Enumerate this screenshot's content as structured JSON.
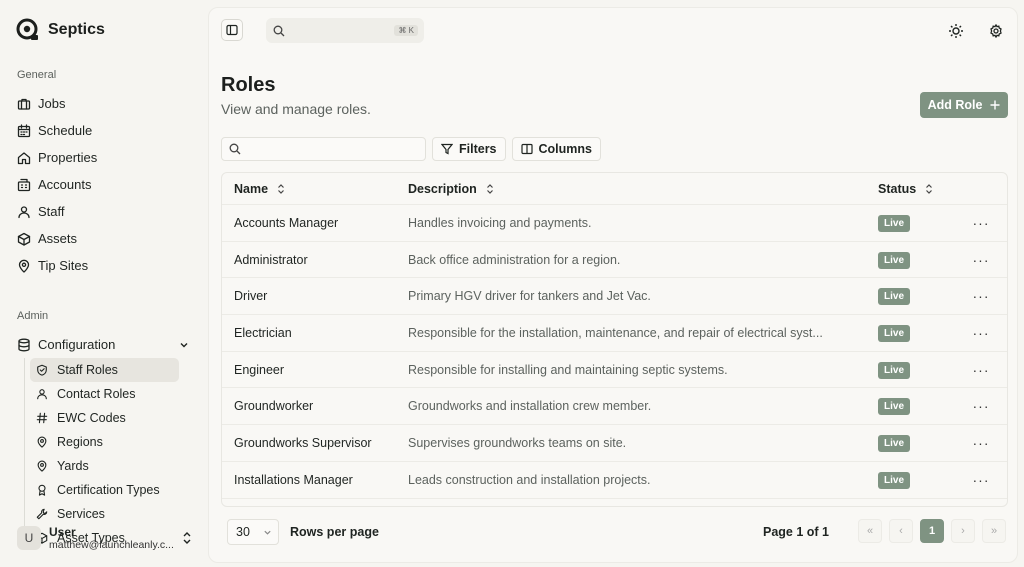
{
  "app": {
    "name": "Septics"
  },
  "sidebar": {
    "general_label": "General",
    "general_items": [
      {
        "label": "Jobs",
        "icon": "briefcase-icon"
      },
      {
        "label": "Schedule",
        "icon": "calendar-icon"
      },
      {
        "label": "Properties",
        "icon": "home-icon"
      },
      {
        "label": "Accounts",
        "icon": "building-icon"
      },
      {
        "label": "Staff",
        "icon": "user-icon"
      },
      {
        "label": "Assets",
        "icon": "box-icon"
      },
      {
        "label": "Tip Sites",
        "icon": "map-pin-icon"
      }
    ],
    "admin_label": "Admin",
    "configuration_label": "Configuration",
    "config_items": [
      {
        "label": "Staff Roles",
        "icon": "shield-icon",
        "active": true
      },
      {
        "label": "Contact Roles",
        "icon": "user-icon"
      },
      {
        "label": "EWC Codes",
        "icon": "hash-icon"
      },
      {
        "label": "Regions",
        "icon": "map-pin-icon"
      },
      {
        "label": "Yards",
        "icon": "map-pin-icon"
      },
      {
        "label": "Certification Types",
        "icon": "award-icon"
      },
      {
        "label": "Services",
        "icon": "wrench-icon"
      },
      {
        "label": "Asset Types",
        "icon": "box-icon"
      }
    ],
    "user": {
      "initial": "U",
      "name": "User",
      "email": "matthew@launchleanly.c..."
    }
  },
  "topbar": {
    "search_shortcut": "⌘ K"
  },
  "page": {
    "title": "Roles",
    "subtitle": "View and manage roles.",
    "add_button": "Add Role"
  },
  "toolbar": {
    "filters_label": "Filters",
    "columns_label": "Columns"
  },
  "table": {
    "headers": {
      "name": "Name",
      "description": "Description",
      "status": "Status"
    },
    "rows": [
      {
        "name": "Accounts Manager",
        "description": "Handles invoicing and payments.",
        "status": "Live"
      },
      {
        "name": "Administrator",
        "description": "Back office administration for a region.",
        "status": "Live"
      },
      {
        "name": "Driver",
        "description": "Primary HGV driver for tankers and Jet Vac.",
        "status": "Live"
      },
      {
        "name": "Electrician",
        "description": "Responsible for the installation, maintenance, and repair of electrical syst...",
        "status": "Live"
      },
      {
        "name": "Engineer",
        "description": "Responsible for installing and maintaining septic systems.",
        "status": "Live"
      },
      {
        "name": "Groundworker",
        "description": "Groundworks and installation crew member.",
        "status": "Live"
      },
      {
        "name": "Groundworks Supervisor",
        "description": "Supervises groundworks teams on site.",
        "status": "Live"
      },
      {
        "name": "Installations Manager",
        "description": "Leads construction and installation projects.",
        "status": "Live"
      }
    ]
  },
  "pagination": {
    "rows_per_page_value": "30",
    "rows_per_page_label": "Rows per page",
    "page_label": "Page 1 of 1",
    "current_page": "1"
  },
  "colors": {
    "accent": "#7f9382",
    "background": "#f6f5f1"
  }
}
